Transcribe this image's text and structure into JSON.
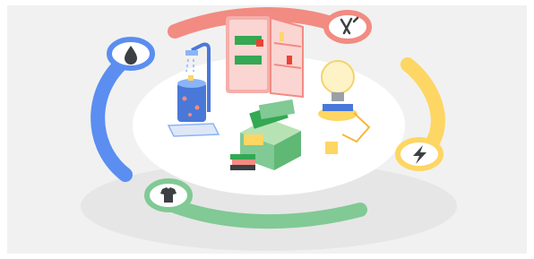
{
  "colors": {
    "backdrop": "#f1f1f1",
    "platform": "#ffffff",
    "blue": "#5b8ef0",
    "red": "#f28b82",
    "yellow": "#fdd663",
    "green": "#81c995",
    "ink": "#3c4043"
  },
  "icons": {
    "water": "water-drop-icon",
    "food": "fork-knife-icon",
    "energy": "lightning-bolt-icon",
    "clothing": "t-shirt-icon"
  }
}
